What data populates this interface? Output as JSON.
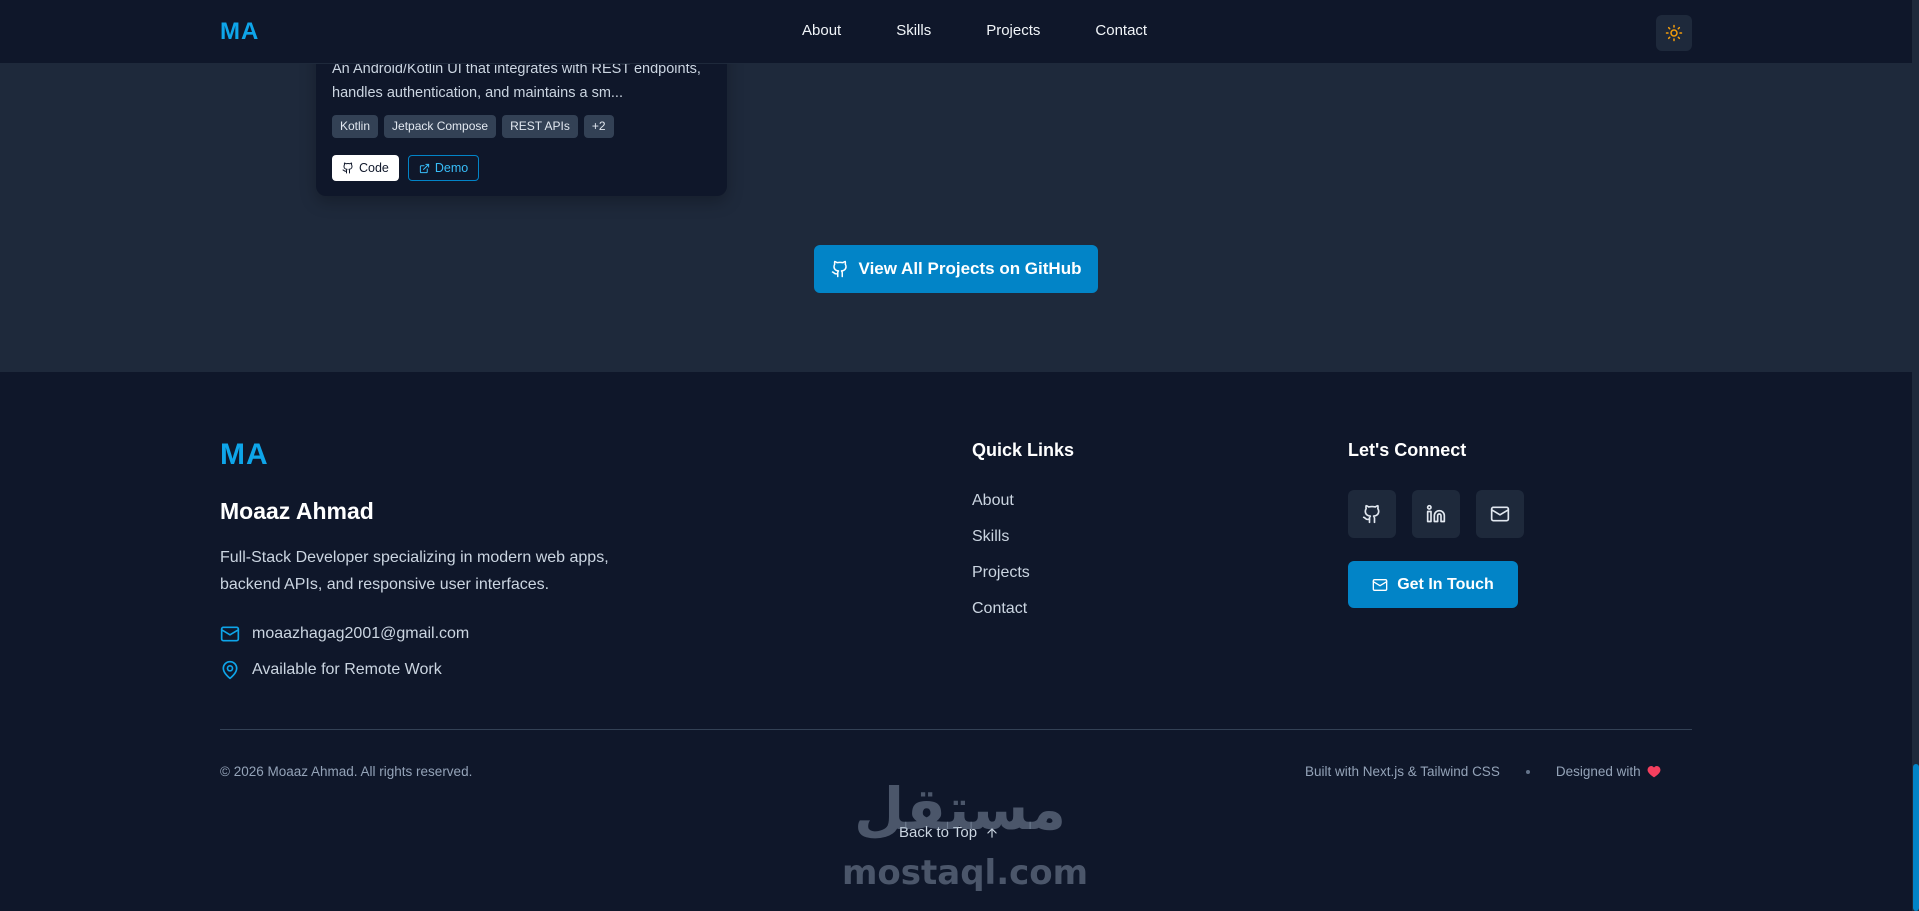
{
  "navbar": {
    "logo": "MA",
    "links": [
      "About",
      "Skills",
      "Projects",
      "Contact"
    ],
    "theme_icon": "sun-icon"
  },
  "project_card": {
    "description": "An Android/Kotlin UI that integrates with REST endpoints, handles authentication, and maintains a sm...",
    "tags": [
      "Kotlin",
      "Jetpack Compose",
      "REST APIs",
      "+2"
    ],
    "code_label": "Code",
    "demo_label": "Demo"
  },
  "view_all_label": "View All Projects on GitHub",
  "footer": {
    "logo": "MA",
    "name": "Moaaz Ahmad",
    "tagline": "Full-Stack Developer specializing in modern web apps, backend APIs, and responsive user interfaces.",
    "email": "moaazhagag2001@gmail.com",
    "location": "Available for Remote Work",
    "quick_links_heading": "Quick Links",
    "quick_links": [
      "About",
      "Skills",
      "Projects",
      "Contact"
    ],
    "connect_heading": "Let's Connect",
    "social_icons": [
      "github-icon",
      "linkedin-icon",
      "mail-icon"
    ],
    "get_in_touch_label": "Get In Touch",
    "copyright": "© 2026 Moaaz Ahmad. All rights reserved.",
    "built_with": "Built with Next.js & Tailwind CSS",
    "designed_with": "Designed with",
    "back_to_top": "Back to Top"
  },
  "watermark": {
    "arabic": "مستقل",
    "latin": "mostaql.com"
  },
  "colors": {
    "accent": "#0284c7",
    "logo": "#0ea5e9",
    "heart": "#f43f5e",
    "sun": "#f59e0b"
  }
}
